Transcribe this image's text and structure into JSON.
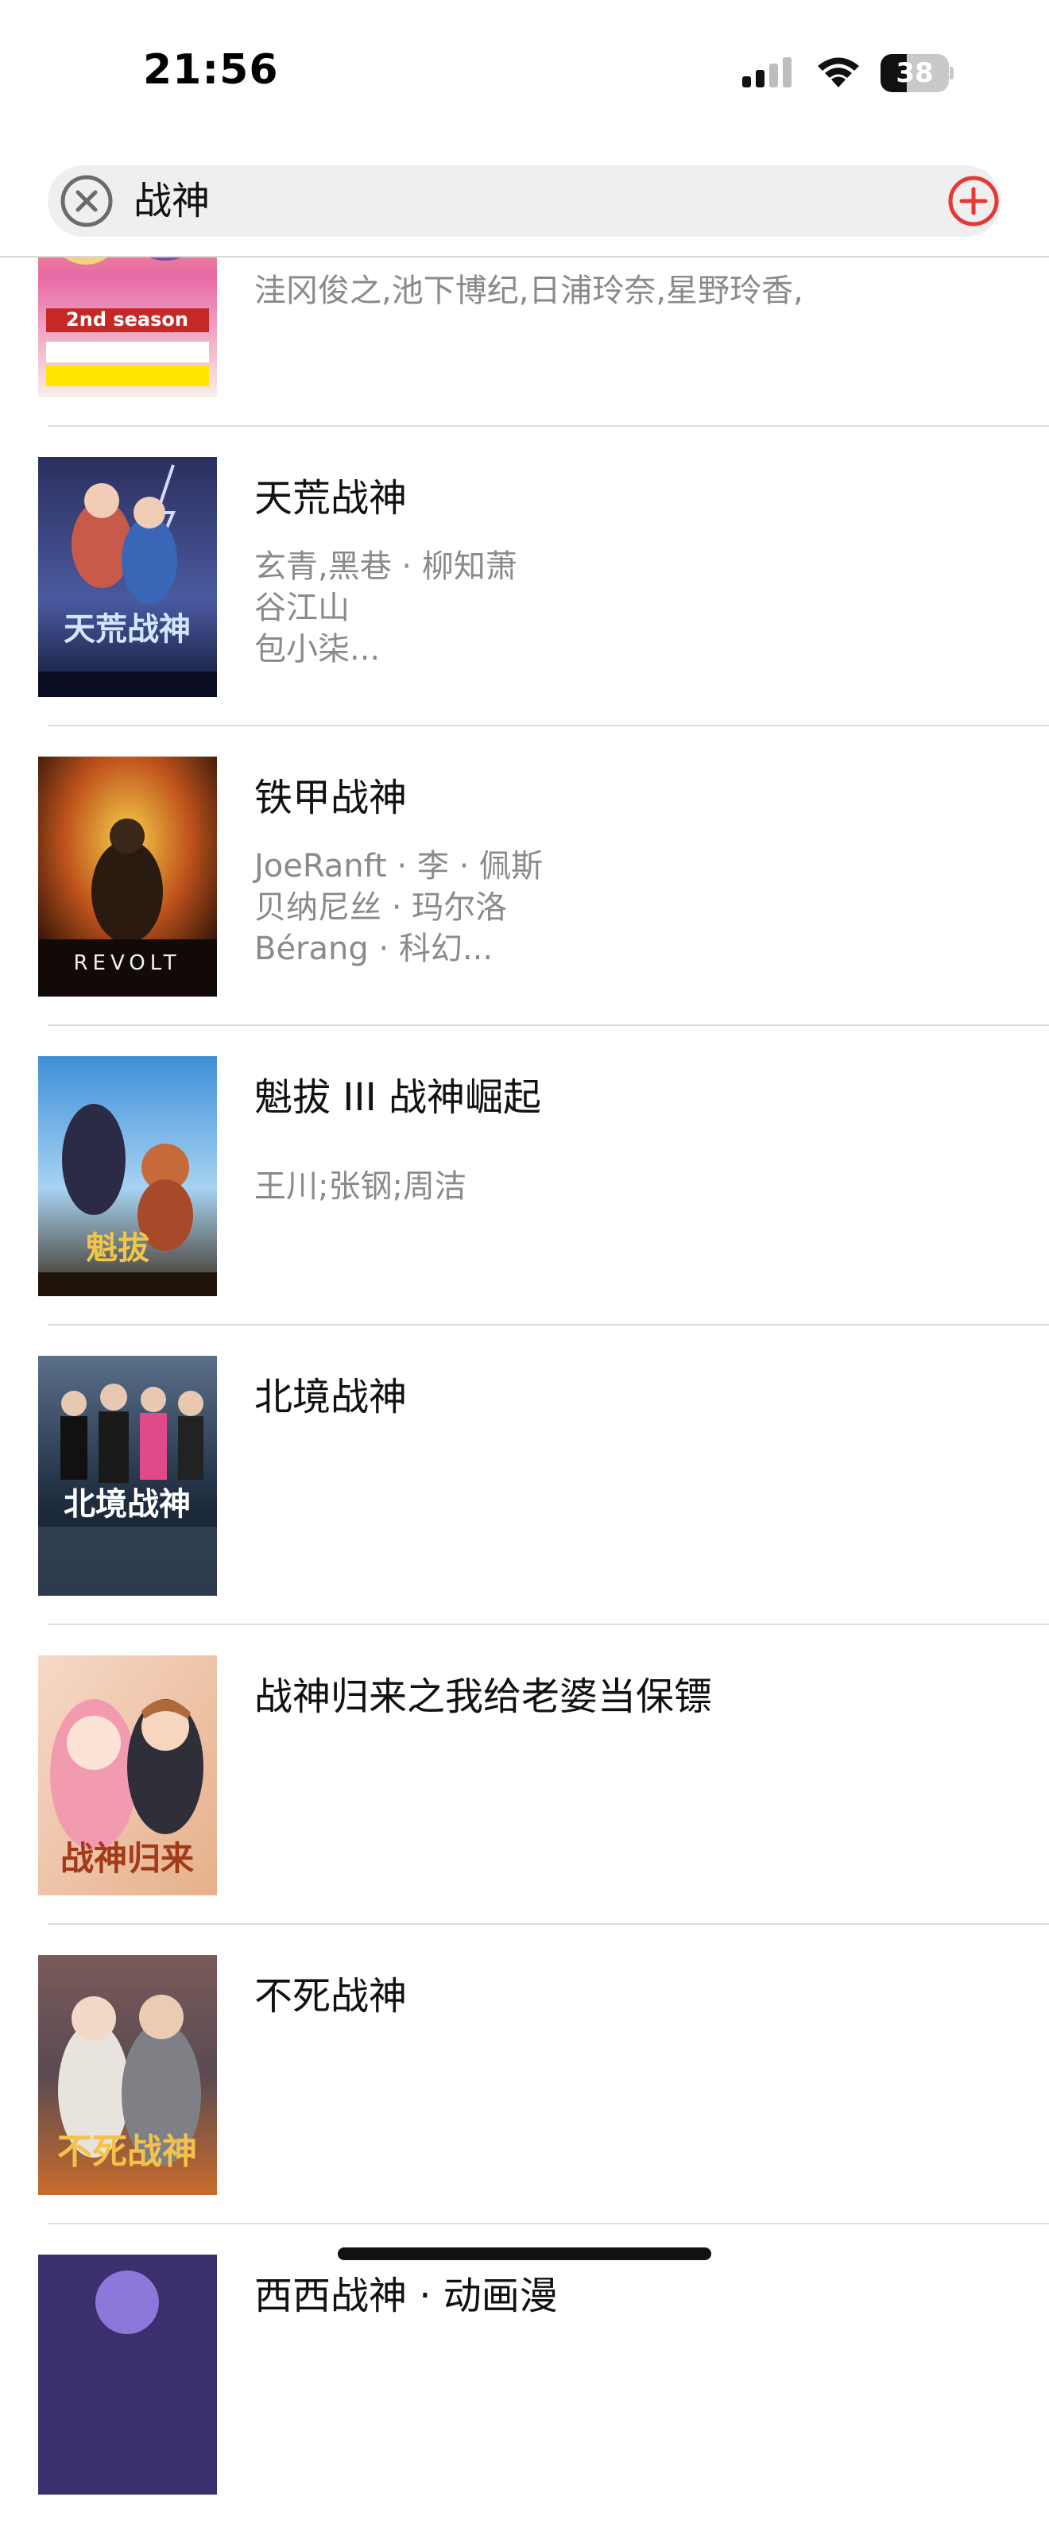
{
  "status": {
    "time": "21:56",
    "battery": "38",
    "battery_level": 0.38
  },
  "search": {
    "query": "战神"
  },
  "results": [
    {
      "title": "",
      "cast": [
        "洼冈俊之,池下博纪,日浦玲奈,星野玲香,"
      ],
      "poster_text": "2nd season"
    },
    {
      "title": "天荒战神",
      "cast": [
        "玄青,黑巷 · 柳知萧",
        "谷江山",
        "包小柒..."
      ],
      "poster_text": "天荒战神"
    },
    {
      "title": "铁甲战神",
      "cast": [
        "JoeRanft · 李 · 佩斯",
        "贝纳尼丝 · 玛尔洛",
        "Bérang · 科幻..."
      ],
      "poster_text": "REVOLT"
    },
    {
      "title": "魁拔 III 战神崛起",
      "cast": [
        "王川;张钢;周洁"
      ],
      "poster_text": "魁拔"
    },
    {
      "title": "北境战神",
      "cast": [],
      "poster_text": "北境战神"
    },
    {
      "title": "战神归来之我给老婆当保镖",
      "cast": [],
      "poster_text": "战神归来"
    },
    {
      "title": "不死战神",
      "cast": [],
      "poster_text": "不死战神"
    },
    {
      "title": "西西战神 · 动画漫",
      "cast": [],
      "poster_text": ""
    }
  ],
  "colors": {
    "accent": "#e53935",
    "secondary_text": "#8a8a8a",
    "divider": "#dddddd",
    "search_bg": "#efefef"
  }
}
